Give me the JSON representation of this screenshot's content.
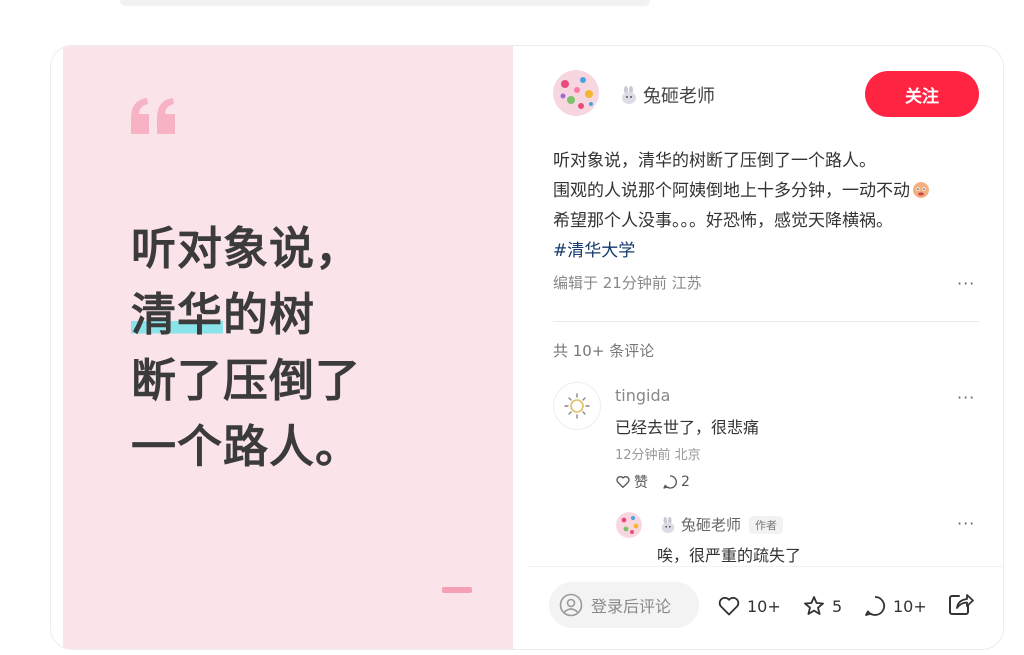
{
  "quote_image": {
    "lines": [
      "听对象说，",
      "清华",
      "的树",
      "断了压倒了",
      "一个路人。"
    ]
  },
  "author": {
    "name": "兔砸老师",
    "follow_label": "关注"
  },
  "post": {
    "lines": [
      "听对象说，清华的树断了压倒了一个路人。",
      "围观的人说那个阿姨倒地上十多分钟，一动不动",
      "希望那个人没事。。。好恐怖，感觉天降横祸。"
    ],
    "hashtag": "#清华大学",
    "meta": "编辑于 21分钟前 江苏"
  },
  "comments": {
    "count_label": "共 10+ 条评论",
    "items": [
      {
        "name": "tingida",
        "text": "已经去世了，很悲痛",
        "meta": "12分钟前 北京",
        "like_label": "赞",
        "reply_count": "2"
      }
    ],
    "reply": {
      "name": "兔砸老师",
      "badge": "作者",
      "text": "唉，很严重的疏失了"
    }
  },
  "bottom_bar": {
    "input_placeholder": "登录后评论",
    "likes": "10+",
    "stars": "5",
    "comments": "10+"
  },
  "more_label": "···",
  "icons": [
    "quote-icon",
    "bunny-icon",
    "emoji-face-icon",
    "sun-icon",
    "heart-icon",
    "chat-icon",
    "user-icon",
    "star-icon",
    "share-icon"
  ],
  "colors": {
    "accent": "#ff2442",
    "left_bg": "#fbe3ea",
    "highlight": "#8be3ea",
    "hashtag": "#13386c"
  }
}
